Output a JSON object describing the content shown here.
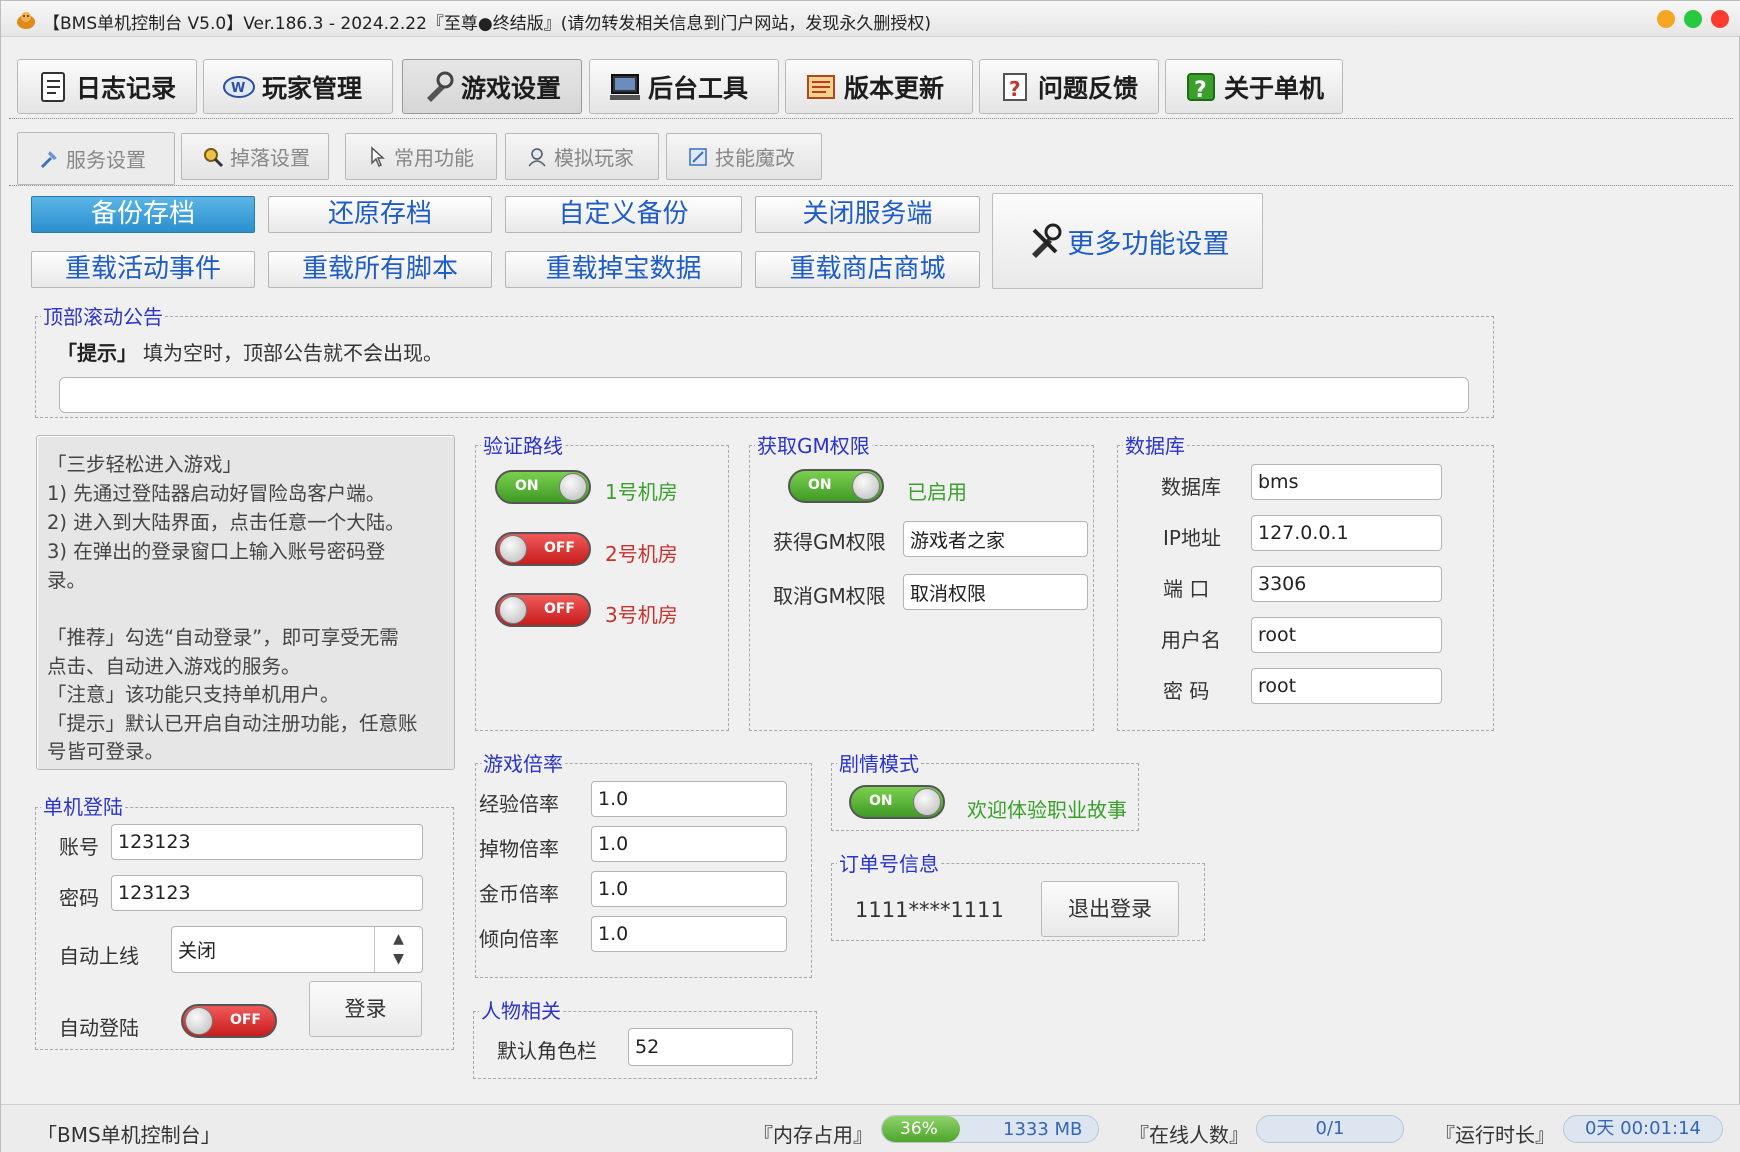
{
  "title": "【BMS单机控制台 V5.0】Ver.186.3 - 2024.2.22『至尊●终结版』(请勿转发相关信息到门户网站，发现永久删授权)",
  "window_buttons": [
    "#f5a623",
    "#27c93f",
    "#ff3b30"
  ],
  "main_tabs": [
    "日志记录",
    "玩家管理",
    "游戏设置",
    "后台工具",
    "版本更新",
    "问题反馈",
    "关于单机"
  ],
  "sub_tabs": [
    "服务设置",
    "掉落设置",
    "常用功能",
    "模拟玩家",
    "技能魔改"
  ],
  "actions": {
    "backup": "备份存档",
    "restore": "还原存档",
    "custom_backup": "自定义备份",
    "close_server": "关闭服务端",
    "reload_events": "重载活动事件",
    "reload_scripts": "重载所有脚本",
    "reload_drops": "重载掉宝数据",
    "reload_shop": "重载商店商城",
    "more": "更多功能设置"
  },
  "notice": {
    "label": "顶部滚动公告",
    "tip_key": "「提示」",
    "tip_text": "填为空时，顶部公告就不会出现。",
    "value": ""
  },
  "info_lines": [
    "「三步轻松进入游戏」",
    "1) 先通过登陆器启动好冒险岛客户端。",
    "2) 进入到大陆界面，点击任意一个大陆。",
    "3) 在弹出的登录窗口上输入账号密码登",
    "录。",
    "「推荐」勾选“自动登录”，即可享受无需",
    "点击、自动进入游戏的服务。",
    "「注意」该功能只支持单机用户。",
    "「提示」默认已开启自动注册功能，任意账",
    "号皆可登录。"
  ],
  "login": {
    "label": "单机登陆",
    "account_label": "账号",
    "account": "123123",
    "password_label": "密码",
    "password": "123123",
    "auto_online_label": "自动上线",
    "auto_online_value": "关闭",
    "auto_login_label": "自动登陆",
    "auto_login_toggle": "OFF",
    "login_button": "登录"
  },
  "verify": {
    "label": "验证路线",
    "routes": [
      {
        "state": "ON",
        "label": "1号机房",
        "color": "#3aa02b"
      },
      {
        "state": "OFF",
        "label": "2号机房",
        "color": "#c8312e"
      },
      {
        "state": "OFF",
        "label": "3号机房",
        "color": "#c8312e"
      }
    ]
  },
  "gm": {
    "label": "获取GM权限",
    "toggle": "ON",
    "status": "已启用",
    "get_label": "获得GM权限",
    "get_value": "游戏者之家",
    "cancel_label": "取消GM权限",
    "cancel_value": "取消权限"
  },
  "db": {
    "label": "数据库",
    "name_label": "数据库",
    "name": "bms",
    "ip_label": "IP地址",
    "ip": "127.0.0.1",
    "port_label": "端 口",
    "port": "3306",
    "user_label": "用户名",
    "user": "root",
    "pass_label": "密 码",
    "pass": "root"
  },
  "rates": {
    "label": "游戏倍率",
    "items": [
      {
        "label": "经验倍率",
        "value": "1.0"
      },
      {
        "label": "掉物倍率",
        "value": "1.0"
      },
      {
        "label": "金币倍率",
        "value": "1.0"
      },
      {
        "label": "倾向倍率",
        "value": "1.0"
      }
    ]
  },
  "story": {
    "label": "剧情模式",
    "toggle": "ON",
    "text": "欢迎体验职业故事"
  },
  "order": {
    "label": "订单号信息",
    "number": "1111****1111",
    "logout": "退出登录"
  },
  "character": {
    "label": "人物相关",
    "slots_label": "默认角色栏",
    "slots": "52"
  },
  "status": {
    "app": "「BMS单机控制台」",
    "mem_label": "『内存占用』",
    "mem_percent": "36%",
    "mem_fraction": 0.36,
    "mem_value": "1333 MB",
    "online_label": "『在线人数』",
    "online": "0/1",
    "uptime_label": "『运行时长』",
    "uptime": "0天 00:01:14"
  }
}
